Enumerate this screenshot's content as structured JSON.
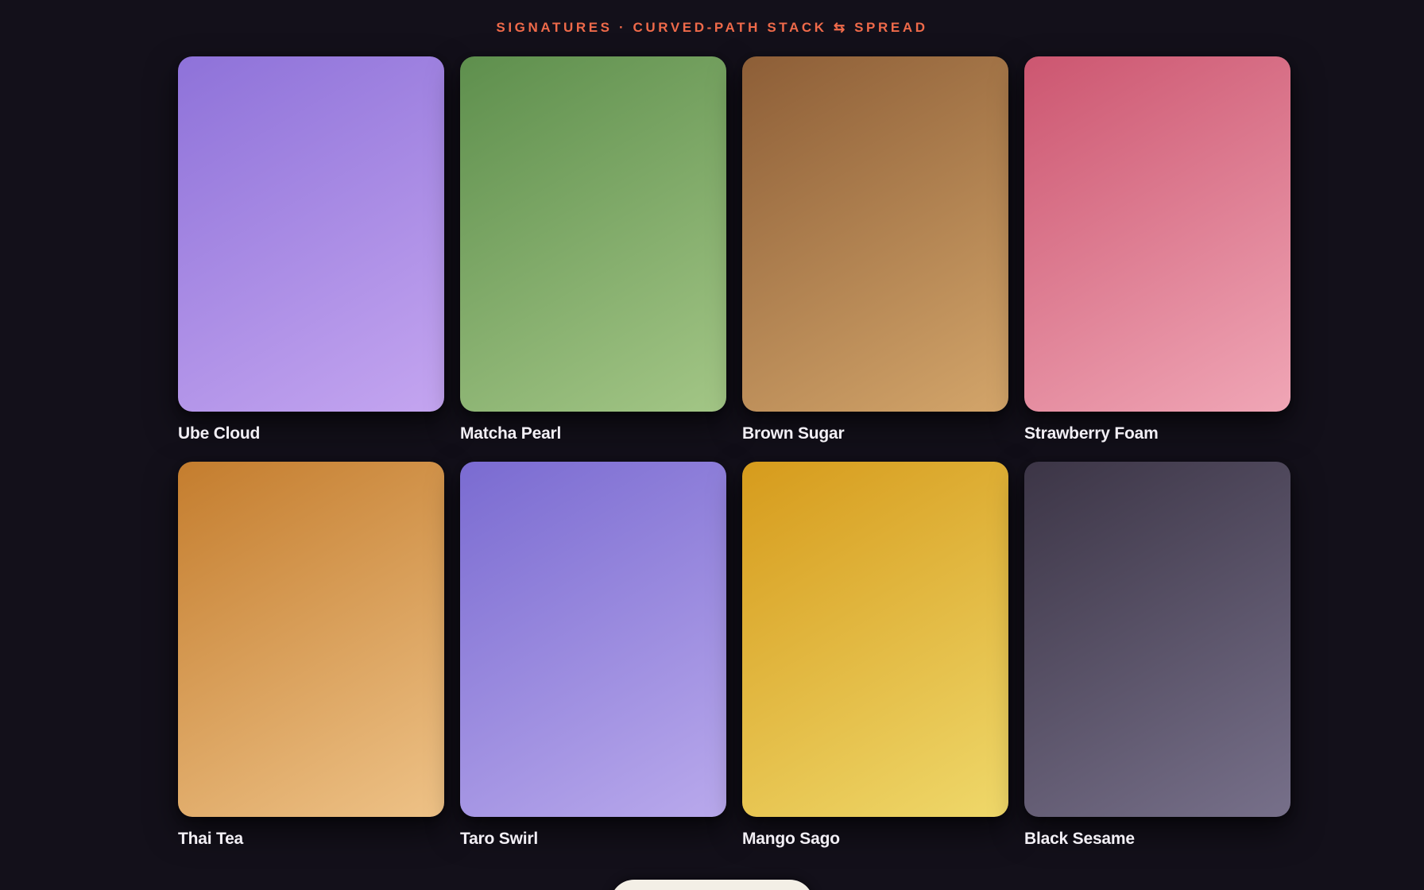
{
  "header": {
    "title": "SIGNATURES · CURVED-PATH STACK ⇆ SPREAD"
  },
  "cards": [
    {
      "label": "Ube Cloud",
      "gradient": [
        "#8e72d9",
        "#c4a5f0"
      ]
    },
    {
      "label": "Matcha Pearl",
      "gradient": [
        "#5e8f4d",
        "#a3c686"
      ]
    },
    {
      "label": "Brown Sugar",
      "gradient": [
        "#8d5e37",
        "#d3a56a"
      ]
    },
    {
      "label": "Strawberry Foam",
      "gradient": [
        "#cc5670",
        "#f0a6b6"
      ]
    },
    {
      "label": "Thai Tea",
      "gradient": [
        "#c47d2e",
        "#eec287"
      ]
    },
    {
      "label": "Taro Swirl",
      "gradient": [
        "#7a6bd1",
        "#b9a9ec"
      ]
    },
    {
      "label": "Mango Sago",
      "gradient": [
        "#d69b1c",
        "#efd86a"
      ]
    },
    {
      "label": "Black Sesame",
      "gradient": [
        "#3c3546",
        "#77708a"
      ]
    }
  ],
  "colors": {
    "background": "#13101a",
    "accent": "#ef6a4a",
    "label": "#f2eff5",
    "button": "#f3efe6"
  }
}
